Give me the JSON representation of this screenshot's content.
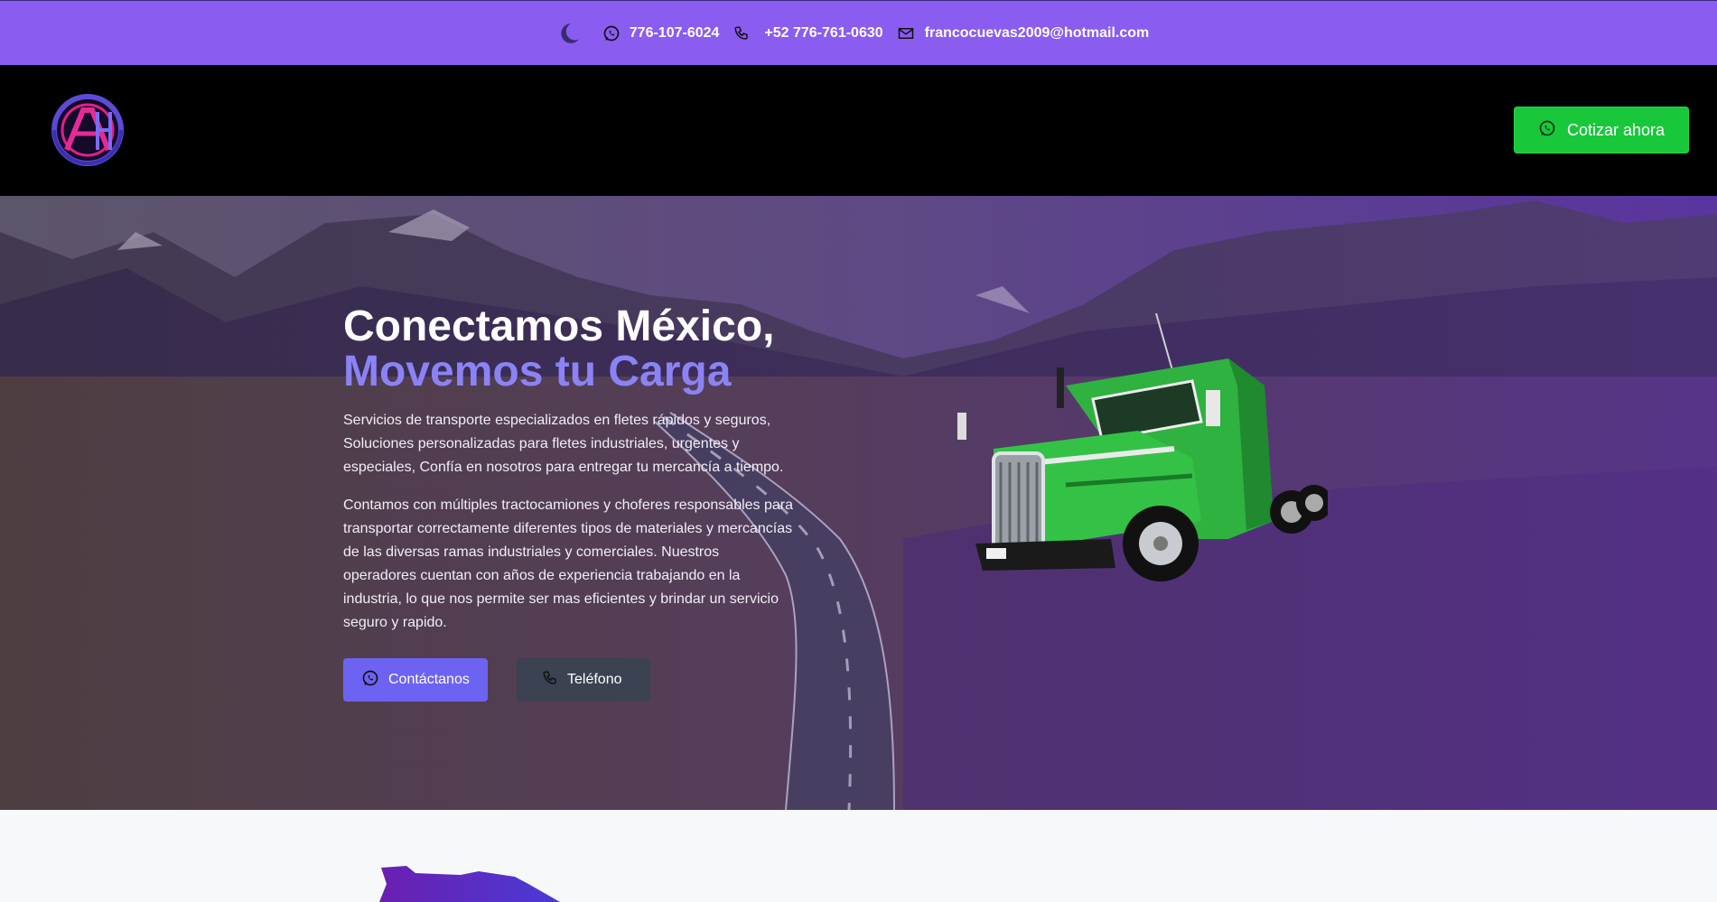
{
  "topbar": {
    "whatsapp": "776-107-6024",
    "phone": "+52 776-761-0630",
    "email": "francocuevas2009@hotmail.com"
  },
  "navbar": {
    "cta_label": "Cotizar ahora"
  },
  "hero": {
    "title_line1": "Conectamos México,",
    "title_line2": "Movemos tu Carga",
    "paragraph1": "Servicios de transporte especializados en fletes rápidos y seguros, Soluciones personalizadas para fletes industriales, urgentes y especiales, Confía en nosotros para entregar tu mercancía a tiempo.",
    "paragraph2": "Contamos con múltiples tractocamiones y choferes responsables para transportar correctamente diferentes tipos de materiales y mercancías de las diversas ramas industriales y comerciales. Nuestros operadores cuentan con años de experiencia trabajando en la industria, lo que nos permite ser mas eficientes y brindar un servicio seguro y rapido.",
    "contact_button": "Contáctanos",
    "phone_button": "Teléfono"
  },
  "colors": {
    "topbar": "#8a5cf0",
    "accent_title": "#8b83f5",
    "cta": "#18c83a",
    "primary_button": "#6d63f2",
    "secondary_button": "#3b4252"
  },
  "icons": [
    "moon-icon",
    "whatsapp-icon",
    "phone-icon",
    "mail-icon",
    "logo"
  ]
}
